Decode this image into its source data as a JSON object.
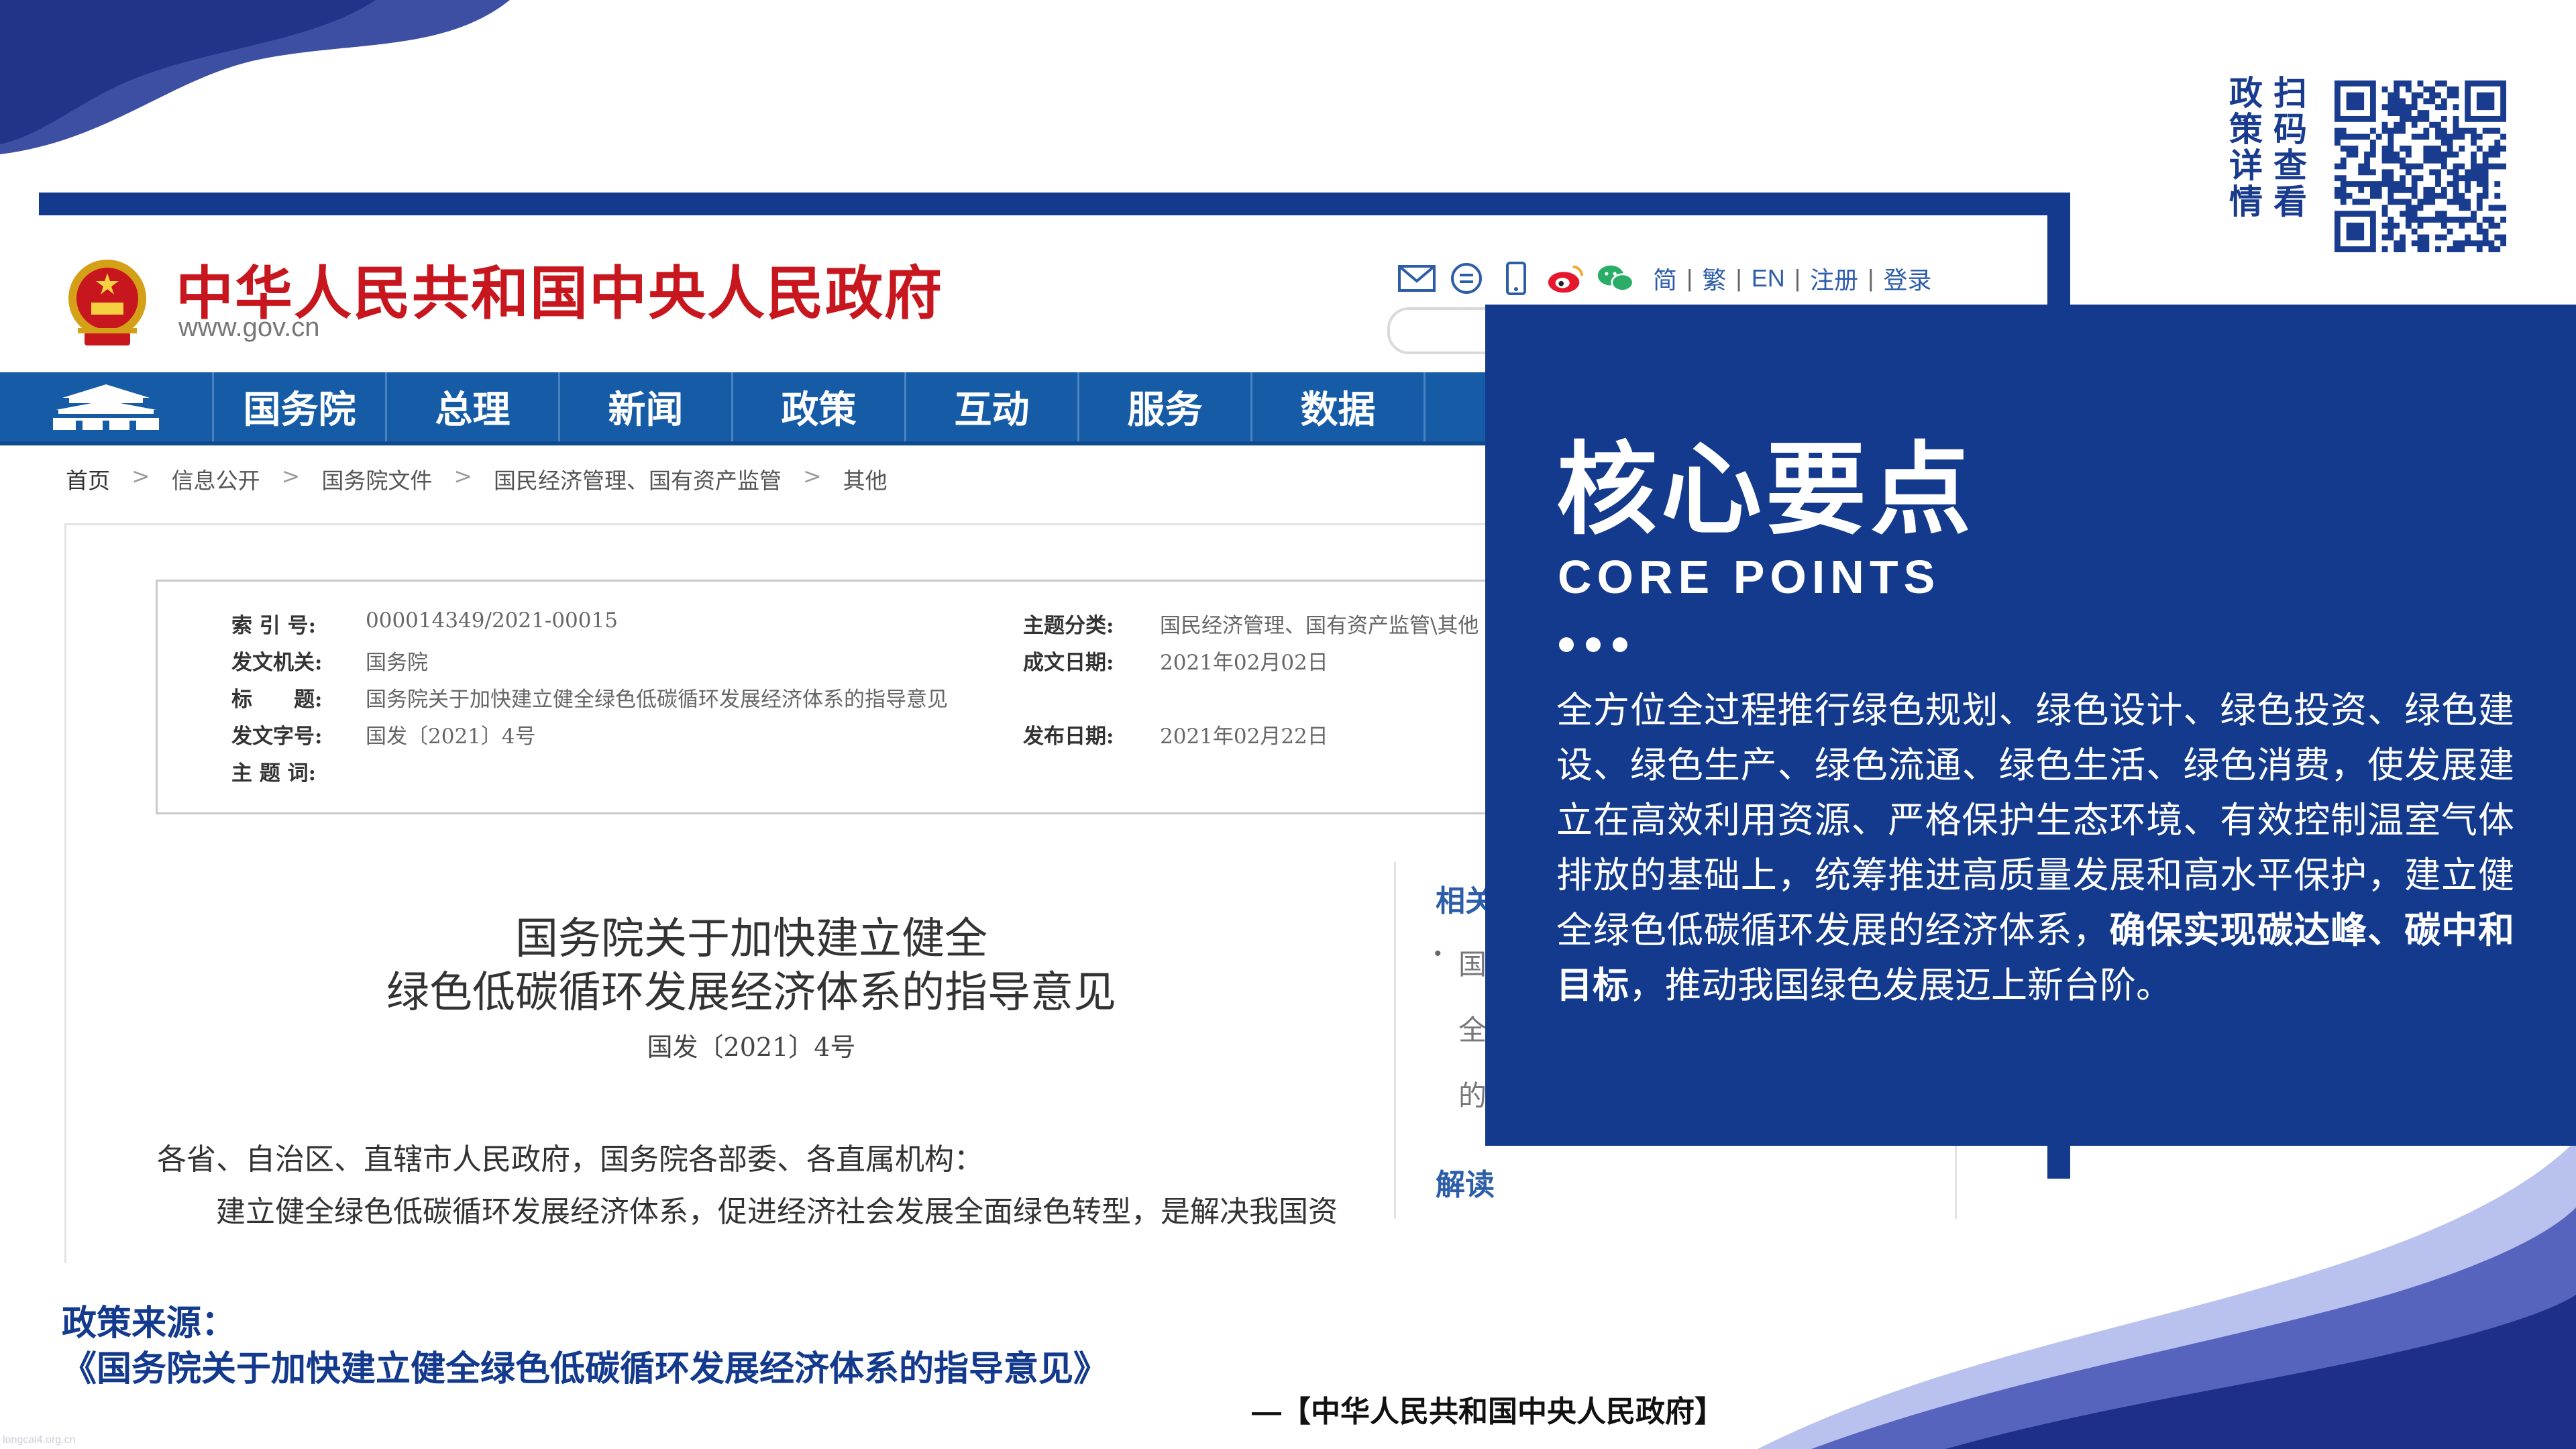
{
  "colors": {
    "brand_blue": "#133a8d",
    "gov_red": "#c7161d",
    "nav_blue": "#155ba6",
    "link_blue": "#2d5da8"
  },
  "qr": {
    "label_chars": [
      "政",
      "策",
      "详",
      "情",
      "扫",
      "码",
      "查",
      "看"
    ],
    "icon": "qr-code-icon"
  },
  "screenshot": {
    "site_title": "中华人民共和国中央人民政府",
    "site_url": "www.gov.cn",
    "toolbar": {
      "icons": [
        "mail-icon",
        "message-icon",
        "mobile-icon",
        "weibo-icon",
        "wechat-icon"
      ],
      "lang_links": [
        "简",
        "繁",
        "EN",
        "注册",
        "登录"
      ],
      "separator": "|"
    },
    "nav": {
      "items": [
        "国务院",
        "总理",
        "新闻",
        "政策",
        "互动",
        "服务",
        "数据"
      ]
    },
    "breadcrumb": {
      "items": [
        "首页",
        "信息公开",
        "国务院文件",
        "国民经济管理、国有资产监管",
        "其他"
      ],
      "separator": ">"
    },
    "meta": {
      "index_label": "索 引 号:",
      "index_value": "000014349/2021-00015",
      "topic_label": "主题分类:",
      "topic_value": "国民经济管理、国有资产监管\\其他",
      "issuer_label": "发文机关:",
      "issuer_value": "国务院",
      "created_label": "成文日期:",
      "created_value": "2021年02月02日",
      "title_label": "标　　题:",
      "title_value": "国务院关于加快建立健全绿色低碳循环发展经济体系的指导意见",
      "docno_label": "发文字号:",
      "docno_value": "国发〔2021〕4号",
      "published_label": "发布日期:",
      "published_value": "2021年02月22日",
      "keywords_label": "主 题 词:"
    },
    "document": {
      "title_line1": "国务院关于加快建立健全",
      "title_line2": "绿色低碳循环发展经济体系的指导意见",
      "number": "国发〔2021〕4号",
      "address": "各省、自治区、直辖市人民政府，国务院各部委、各直属机构：",
      "body_start": "建立健全绿色低碳循环发展经济体系，促进经济社会发展全面绿色转型，是解决我国资"
    },
    "sidebar": {
      "related_head": "相关",
      "bullet": "•",
      "lines": [
        "国",
        "全",
        "的"
      ],
      "jiedu": "解读"
    }
  },
  "card": {
    "title_cn": "核心要点",
    "title_en": "CORE POINTS",
    "body_text": "全方位全过程推行绿色规划、绿色设计、绿色投资、绿色建设、绿色生产、绿色流通、绿色生活、绿色消费，使发展建立在高效利用资源、严格保护生态环境、有效控制温室气体排放的基础上，统筹推进高质量发展和高水平保护，建立健全绿色低碳循环发展的经济体系，",
    "body_bold": "确保实现碳达峰、碳中和目标",
    "body_end": "，推动我国绿色发展迈上新台阶。"
  },
  "footer": {
    "source_label": "政策来源：",
    "source_title": "《国务院关于加快建立健全绿色低碳循环发展经济体系的指导意见》",
    "source_credit": "—【中华人民共和国中央人民政府】",
    "watermark": "longcai4.org.cn"
  }
}
